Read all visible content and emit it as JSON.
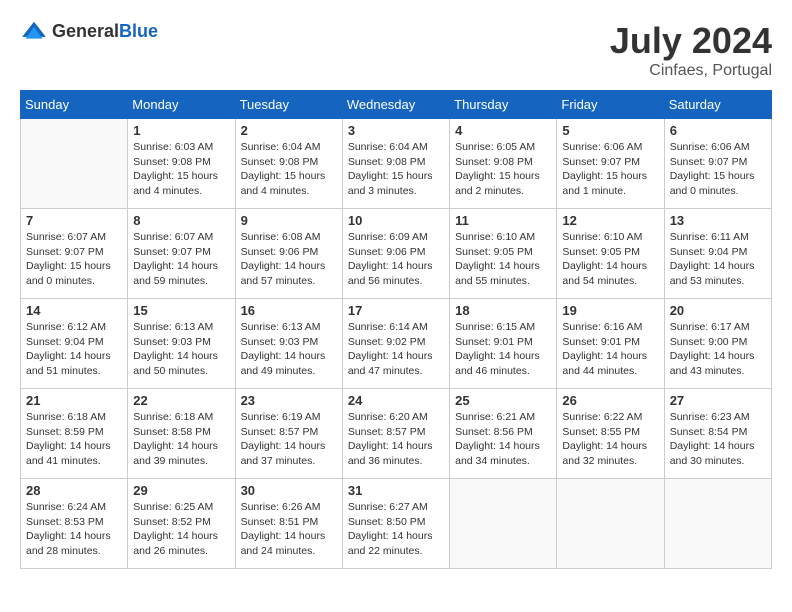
{
  "header": {
    "logo_general": "General",
    "logo_blue": "Blue",
    "month": "July 2024",
    "location": "Cinfaes, Portugal"
  },
  "weekdays": [
    "Sunday",
    "Monday",
    "Tuesday",
    "Wednesday",
    "Thursday",
    "Friday",
    "Saturday"
  ],
  "weeks": [
    [
      {
        "day": null
      },
      {
        "day": "1",
        "sunrise": "6:03 AM",
        "sunset": "9:08 PM",
        "daylight": "15 hours and 4 minutes."
      },
      {
        "day": "2",
        "sunrise": "6:04 AM",
        "sunset": "9:08 PM",
        "daylight": "15 hours and 4 minutes."
      },
      {
        "day": "3",
        "sunrise": "6:04 AM",
        "sunset": "9:08 PM",
        "daylight": "15 hours and 3 minutes."
      },
      {
        "day": "4",
        "sunrise": "6:05 AM",
        "sunset": "9:08 PM",
        "daylight": "15 hours and 2 minutes."
      },
      {
        "day": "5",
        "sunrise": "6:06 AM",
        "sunset": "9:07 PM",
        "daylight": "15 hours and 1 minute."
      },
      {
        "day": "6",
        "sunrise": "6:06 AM",
        "sunset": "9:07 PM",
        "daylight": "15 hours and 0 minutes."
      }
    ],
    [
      {
        "day": "7",
        "sunrise": "6:07 AM",
        "sunset": "9:07 PM",
        "daylight": "15 hours and 0 minutes."
      },
      {
        "day": "8",
        "sunrise": "6:07 AM",
        "sunset": "9:07 PM",
        "daylight": "14 hours and 59 minutes."
      },
      {
        "day": "9",
        "sunrise": "6:08 AM",
        "sunset": "9:06 PM",
        "daylight": "14 hours and 57 minutes."
      },
      {
        "day": "10",
        "sunrise": "6:09 AM",
        "sunset": "9:06 PM",
        "daylight": "14 hours and 56 minutes."
      },
      {
        "day": "11",
        "sunrise": "6:10 AM",
        "sunset": "9:05 PM",
        "daylight": "14 hours and 55 minutes."
      },
      {
        "day": "12",
        "sunrise": "6:10 AM",
        "sunset": "9:05 PM",
        "daylight": "14 hours and 54 minutes."
      },
      {
        "day": "13",
        "sunrise": "6:11 AM",
        "sunset": "9:04 PM",
        "daylight": "14 hours and 53 minutes."
      }
    ],
    [
      {
        "day": "14",
        "sunrise": "6:12 AM",
        "sunset": "9:04 PM",
        "daylight": "14 hours and 51 minutes."
      },
      {
        "day": "15",
        "sunrise": "6:13 AM",
        "sunset": "9:03 PM",
        "daylight": "14 hours and 50 minutes."
      },
      {
        "day": "16",
        "sunrise": "6:13 AM",
        "sunset": "9:03 PM",
        "daylight": "14 hours and 49 minutes."
      },
      {
        "day": "17",
        "sunrise": "6:14 AM",
        "sunset": "9:02 PM",
        "daylight": "14 hours and 47 minutes."
      },
      {
        "day": "18",
        "sunrise": "6:15 AM",
        "sunset": "9:01 PM",
        "daylight": "14 hours and 46 minutes."
      },
      {
        "day": "19",
        "sunrise": "6:16 AM",
        "sunset": "9:01 PM",
        "daylight": "14 hours and 44 minutes."
      },
      {
        "day": "20",
        "sunrise": "6:17 AM",
        "sunset": "9:00 PM",
        "daylight": "14 hours and 43 minutes."
      }
    ],
    [
      {
        "day": "21",
        "sunrise": "6:18 AM",
        "sunset": "8:59 PM",
        "daylight": "14 hours and 41 minutes."
      },
      {
        "day": "22",
        "sunrise": "6:18 AM",
        "sunset": "8:58 PM",
        "daylight": "14 hours and 39 minutes."
      },
      {
        "day": "23",
        "sunrise": "6:19 AM",
        "sunset": "8:57 PM",
        "daylight": "14 hours and 37 minutes."
      },
      {
        "day": "24",
        "sunrise": "6:20 AM",
        "sunset": "8:57 PM",
        "daylight": "14 hours and 36 minutes."
      },
      {
        "day": "25",
        "sunrise": "6:21 AM",
        "sunset": "8:56 PM",
        "daylight": "14 hours and 34 minutes."
      },
      {
        "day": "26",
        "sunrise": "6:22 AM",
        "sunset": "8:55 PM",
        "daylight": "14 hours and 32 minutes."
      },
      {
        "day": "27",
        "sunrise": "6:23 AM",
        "sunset": "8:54 PM",
        "daylight": "14 hours and 30 minutes."
      }
    ],
    [
      {
        "day": "28",
        "sunrise": "6:24 AM",
        "sunset": "8:53 PM",
        "daylight": "14 hours and 28 minutes."
      },
      {
        "day": "29",
        "sunrise": "6:25 AM",
        "sunset": "8:52 PM",
        "daylight": "14 hours and 26 minutes."
      },
      {
        "day": "30",
        "sunrise": "6:26 AM",
        "sunset": "8:51 PM",
        "daylight": "14 hours and 24 minutes."
      },
      {
        "day": "31",
        "sunrise": "6:27 AM",
        "sunset": "8:50 PM",
        "daylight": "14 hours and 22 minutes."
      },
      {
        "day": null
      },
      {
        "day": null
      },
      {
        "day": null
      }
    ]
  ]
}
